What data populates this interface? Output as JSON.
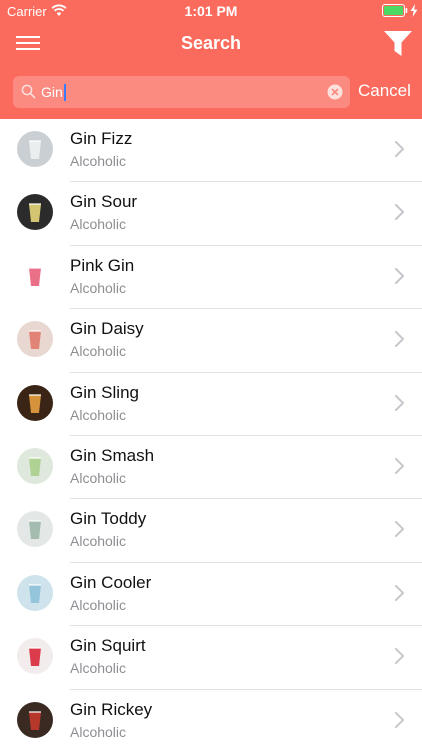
{
  "status_bar": {
    "carrier": "Carrier",
    "time": "1:01 PM",
    "wifi_icon": "wifi-icon",
    "battery_icon": "battery-icon",
    "battery_color": "#4cd964"
  },
  "nav": {
    "title": "Search",
    "menu_icon": "hamburger-menu-icon",
    "filter_icon": "filter-funnel-icon"
  },
  "search": {
    "value": "Gin",
    "cancel_label": "Cancel"
  },
  "colors": {
    "header": "#fb6b5d",
    "search_field": "#fb8a80",
    "caret": "#3c7cff"
  },
  "results": [
    {
      "name": "Gin Fizz",
      "category": "Alcoholic",
      "thumb": {
        "bg": "#c9cfd3",
        "accent": "#eef1f2"
      }
    },
    {
      "name": "Gin Sour",
      "category": "Alcoholic",
      "thumb": {
        "bg": "#2b2b2b",
        "accent": "#e6d67a"
      }
    },
    {
      "name": "Pink Gin",
      "category": "Alcoholic",
      "thumb": {
        "bg": "#ffffff",
        "accent": "#e8607a"
      }
    },
    {
      "name": "Gin Daisy",
      "category": "Alcoholic",
      "thumb": {
        "bg": "#e9d7d2",
        "accent": "#e07a6a"
      }
    },
    {
      "name": "Gin Sling",
      "category": "Alcoholic",
      "thumb": {
        "bg": "#3a2416",
        "accent": "#e8a040"
      }
    },
    {
      "name": "Gin Smash",
      "category": "Alcoholic",
      "thumb": {
        "bg": "#dfe8dc",
        "accent": "#a9cf8c"
      }
    },
    {
      "name": "Gin Toddy",
      "category": "Alcoholic",
      "thumb": {
        "bg": "#e3e8e6",
        "accent": "#9bb7a8"
      }
    },
    {
      "name": "Gin Cooler",
      "category": "Alcoholic",
      "thumb": {
        "bg": "#cfe3ec",
        "accent": "#8ec1d8"
      }
    },
    {
      "name": "Gin Squirt",
      "category": "Alcoholic",
      "thumb": {
        "bg": "#f2ecec",
        "accent": "#d8283a"
      }
    },
    {
      "name": "Gin Rickey",
      "category": "Alcoholic",
      "thumb": {
        "bg": "#3a2a22",
        "accent": "#c43a2c"
      }
    }
  ]
}
